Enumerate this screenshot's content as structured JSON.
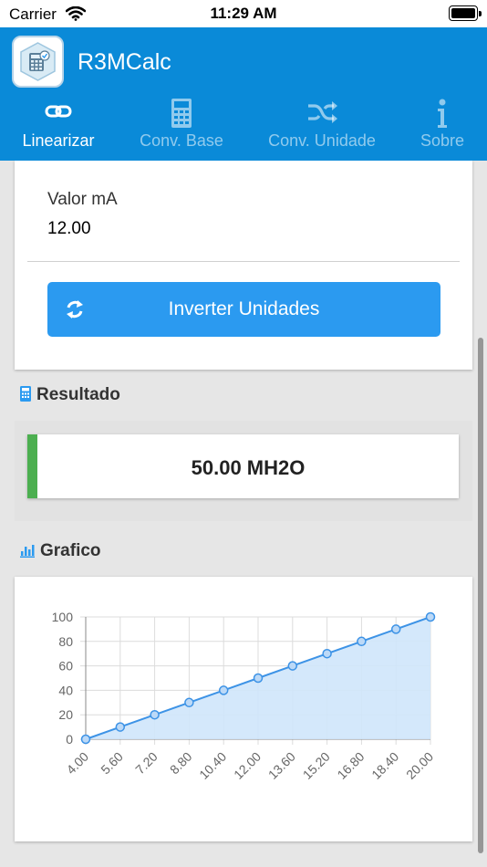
{
  "status_bar": {
    "carrier": "Carrier",
    "time": "11:29 AM"
  },
  "app": {
    "title": "R3MCalc",
    "icon": "calculator-app-icon"
  },
  "tabs": [
    {
      "label": "Linearizar",
      "icon": "link-icon",
      "active": true
    },
    {
      "label": "Conv. Base",
      "icon": "calculator-icon",
      "active": false
    },
    {
      "label": "Conv. Unidade",
      "icon": "shuffle-icon",
      "active": false
    },
    {
      "label": "Sobre",
      "icon": "info-icon",
      "active": false
    }
  ],
  "input": {
    "label": "Valor mA",
    "value": "12.00"
  },
  "invert_button": {
    "label": "Inverter Unidades",
    "icon": "refresh-icon"
  },
  "result": {
    "title": "Resultado",
    "icon": "calculator-icon",
    "value": "50.00 MH2O",
    "accent_color": "#4caf50"
  },
  "chart_section": {
    "title": "Grafico",
    "icon": "bar-chart-icon"
  },
  "colors": {
    "header": "#0a8ad8",
    "button": "#2b9af0",
    "chart_line": "#3d93e6",
    "chart_fill": "#cfe5fb"
  },
  "chart_data": {
    "type": "area",
    "x": [
      "4.00",
      "5.60",
      "7.20",
      "8.80",
      "10.40",
      "12.00",
      "13.60",
      "15.20",
      "16.80",
      "18.40",
      "20.00"
    ],
    "values": [
      0,
      10,
      20,
      30,
      40,
      50,
      60,
      70,
      80,
      90,
      100
    ],
    "y_ticks": [
      "0",
      "20",
      "40",
      "60",
      "80",
      "100"
    ],
    "ylim": [
      0,
      100
    ],
    "grid": true,
    "title": "",
    "xlabel": "",
    "ylabel": ""
  }
}
